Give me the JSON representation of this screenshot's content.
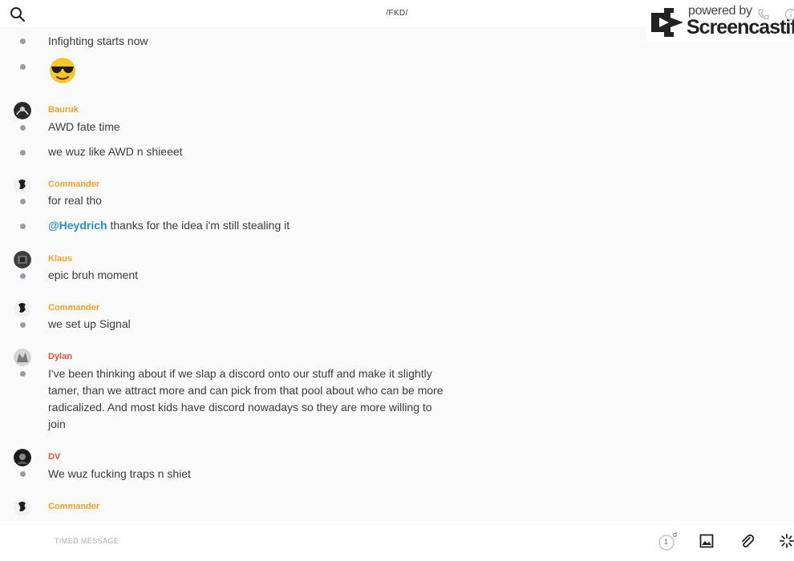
{
  "header": {
    "title": "/FKD/",
    "search_icon": "search-icon"
  },
  "watermark": {
    "powered_by": "powered by",
    "brand": "Screencastify"
  },
  "messages": [
    {
      "type": "text",
      "text": "Infighting starts now"
    },
    {
      "type": "emoji",
      "emoji": "smiling-face-with-sunglasses"
    },
    {
      "type": "sender",
      "name": "Bauruk",
      "color": "#f0a030"
    },
    {
      "type": "text",
      "text": "AWD fate time"
    },
    {
      "type": "text",
      "text": "we wuz like AWD n shieeet"
    },
    {
      "type": "sender",
      "name": "Commander",
      "color": "#f0a030"
    },
    {
      "type": "text",
      "text": "for real tho"
    },
    {
      "type": "mention",
      "mention": "@Heydrich",
      "text": " thanks for the idea i'm still stealing it"
    },
    {
      "type": "sender",
      "name": "Klaus",
      "color": "#f0a030"
    },
    {
      "type": "text",
      "text": "epic bruh moment"
    },
    {
      "type": "sender",
      "name": "Commander",
      "color": "#f0a030"
    },
    {
      "type": "text",
      "text": "we set up Signal"
    },
    {
      "type": "sender",
      "name": "Dylan",
      "color": "#e2523e"
    },
    {
      "type": "text",
      "text": "I've been thinking about if we slap a discord onto our stuff and make it slightly tamer, than we attract more and can pick from that pool about who can be more radicalized. And most kids have discord nowadays so they are more willing to join"
    },
    {
      "type": "sender",
      "name": "DV",
      "color": "#e2523e"
    },
    {
      "type": "text",
      "text": "We wuz fucking traps n shiet"
    },
    {
      "type": "sender",
      "name": "Commander",
      "color": "#f0a030"
    }
  ],
  "composer": {
    "placeholder": "TIMED MESSAGE",
    "timer_value": "1",
    "timer_unit": "d"
  }
}
